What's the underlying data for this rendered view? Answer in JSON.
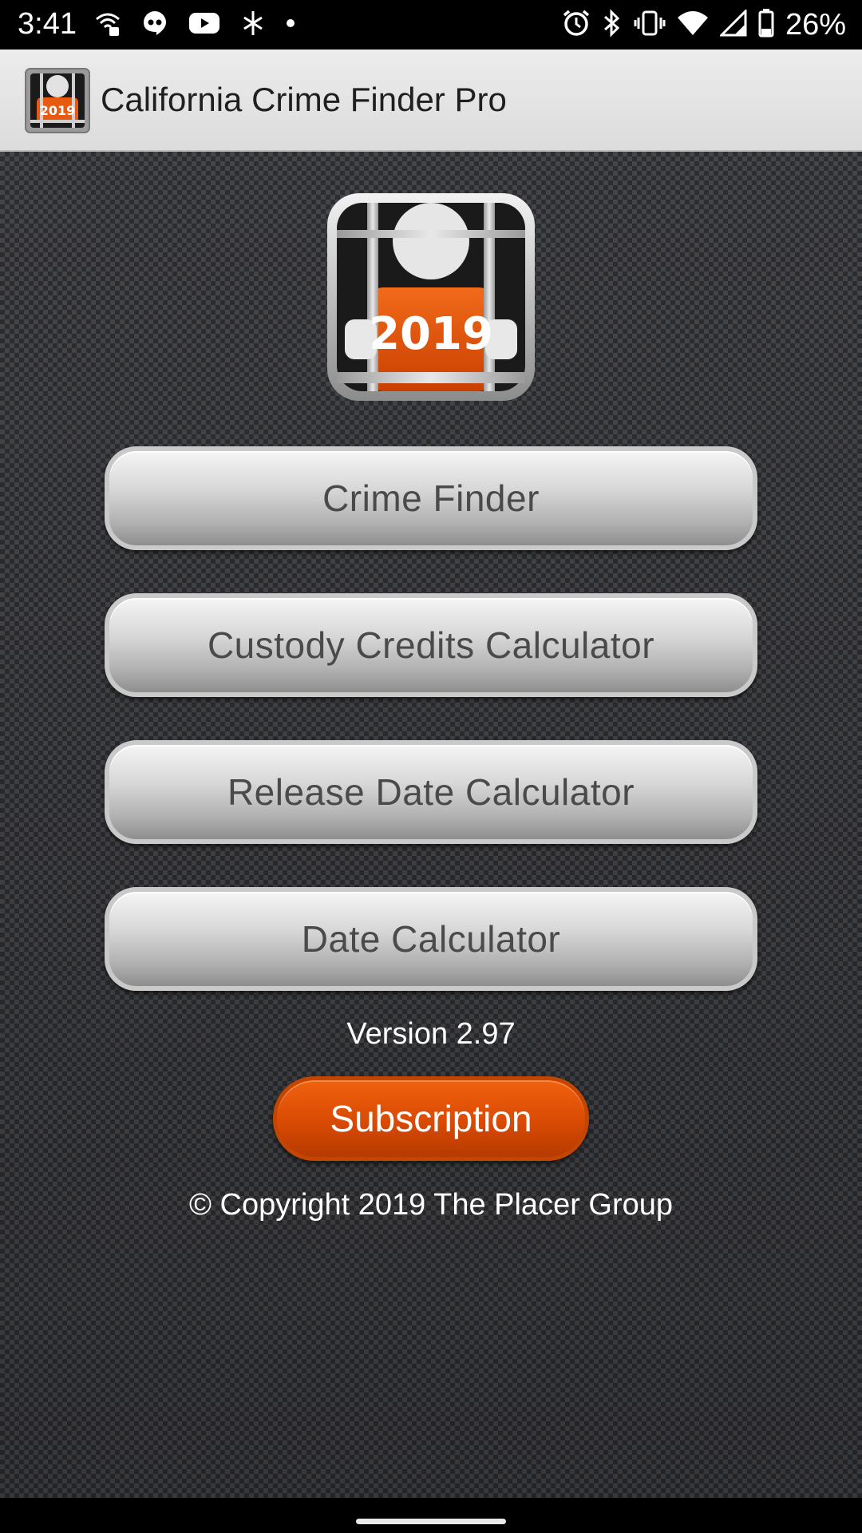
{
  "status_bar": {
    "time": "3:41",
    "battery_percent": "26%",
    "left_icons": [
      "wifi-call-icon",
      "hangouts-icon",
      "youtube-icon",
      "sparkle-icon",
      "dot-icon"
    ],
    "right_icons": [
      "alarm-icon",
      "bluetooth-icon",
      "vibrate-icon",
      "wifi-icon",
      "cell-signal-icon",
      "battery-icon"
    ]
  },
  "app_bar": {
    "title": "California Crime Finder Pro",
    "icon": "prisoner-2019-icon"
  },
  "logo": {
    "year_label": "2019"
  },
  "menu": {
    "crime_finder": "Crime Finder",
    "custody_credits": "Custody Credits Calculator",
    "release_date": "Release Date Calculator",
    "date_calculator": "Date Calculator"
  },
  "version": "Version 2.97",
  "subscription_label": "Subscription",
  "copyright": "© Copyright 2019 The Placer Group",
  "colors": {
    "accent_orange": "#e0500a",
    "background": "#3d3e42",
    "app_bar": "#e4e4e4"
  }
}
